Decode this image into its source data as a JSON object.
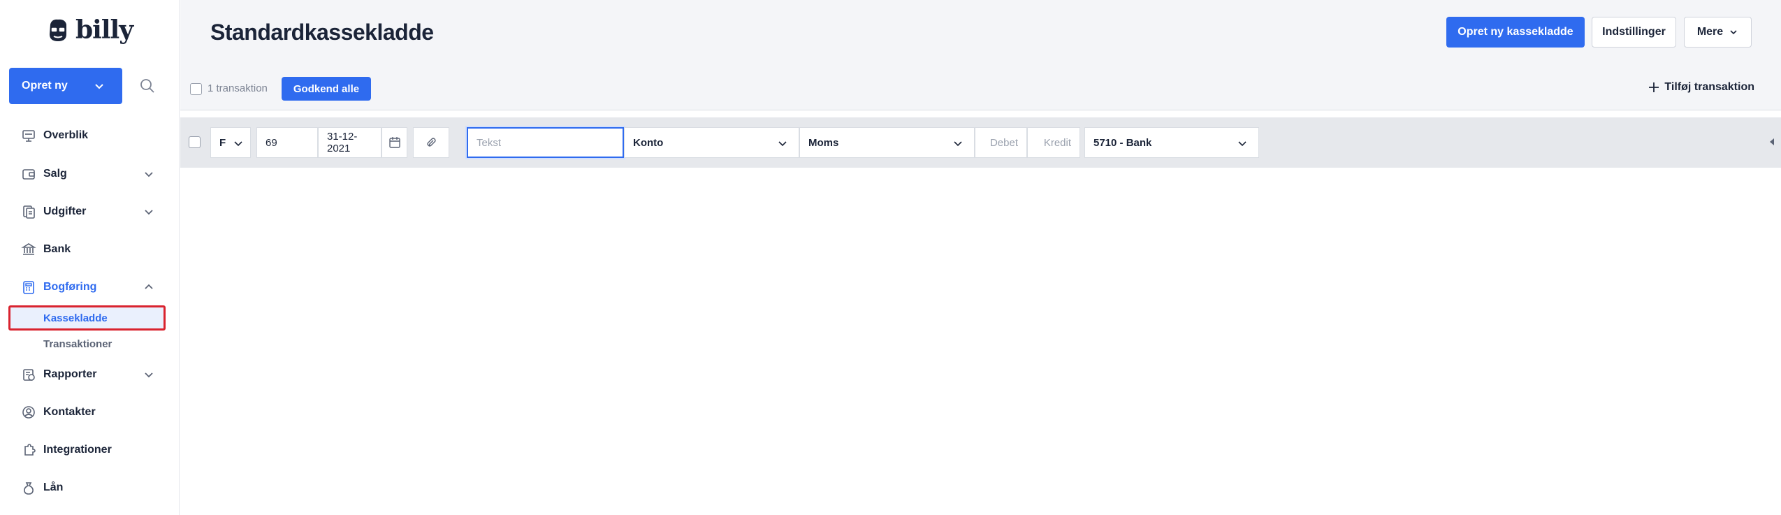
{
  "app": {
    "logo_text": "billy"
  },
  "sidebar": {
    "create_label": "Opret ny",
    "items": [
      {
        "label": "Overblik",
        "icon": "dashboard-icon"
      },
      {
        "label": "Salg",
        "icon": "sales-icon"
      },
      {
        "label": "Udgifter",
        "icon": "expenses-icon"
      },
      {
        "label": "Bank",
        "icon": "bank-icon"
      },
      {
        "label": "Bogføring",
        "icon": "calculator-icon"
      },
      {
        "label": "Rapporter",
        "icon": "reports-icon"
      },
      {
        "label": "Kontakter",
        "icon": "contacts-icon"
      },
      {
        "label": "Integrationer",
        "icon": "integrations-icon"
      },
      {
        "label": "Lån",
        "icon": "loan-icon"
      }
    ],
    "subitems": [
      {
        "label": "Kassekladde"
      },
      {
        "label": "Transaktioner"
      }
    ]
  },
  "header": {
    "title": "Standardkassekladde",
    "new_button": "Opret ny kassekladde",
    "settings_button": "Indstillinger",
    "more_button": "Mere"
  },
  "toolbar": {
    "count_label": "1 transaktion",
    "approve_all": "Godkend alle",
    "add_transaction": "Tilføj transaktion"
  },
  "row": {
    "type": "F",
    "number": "69",
    "date": "31-12-2021",
    "text_placeholder": "Tekst",
    "account_placeholder": "Konto",
    "vat_placeholder": "Moms",
    "debit_placeholder": "Debet",
    "credit_placeholder": "Kredit",
    "counter_account": "5710 - Bank"
  },
  "colors": {
    "accent": "#2f6bef",
    "highlight_border": "#d9232f"
  }
}
